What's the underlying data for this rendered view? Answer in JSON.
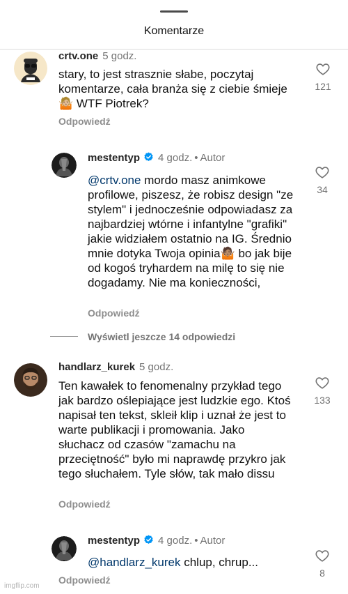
{
  "header": {
    "title": "Komentarze"
  },
  "comments": [
    {
      "username": "crtv.one",
      "time": "5 godz.",
      "text": "stary, to jest strasznie słabe, poczytaj komentarze, cała branża się z ciebie śmieje 🤷🏼 WTF Piotrek?",
      "likes": "121",
      "reply_label": "Odpowiedź"
    },
    {
      "username": "mestentyp",
      "verified": true,
      "time": "4 godz.",
      "separator": "•",
      "author_label": "Autor",
      "mention": "@crtv.one",
      "text": " mordo masz animkowe profilowe, piszesz, że robisz design \"ze stylem\" i jednocześnie odpowiadasz za najbardziej wtórne i infantylne \"grafiki\" jakie widziałem ostatnio na IG. Średnio mnie dotyka Twoja opinia🤷🏽 bo jak bije od kogoś tryhardem na milę to się nie dogadamy. Nie ma konieczności,",
      "likes": "34",
      "reply_label": "Odpowiedź"
    },
    {
      "username": "handlarz_kurek",
      "time": "5 godz.",
      "text": "Ten kawałek to fenomenalny przykład tego jak bardzo oślepiające jest ludzkie ego. Ktoś napisał ten tekst, skleił klip i uznał że jest to warte publikacji i promowania. Jako słuchacz od czasów \"zamachu na przeciętność\" było mi naprawdę przykro jak tego słuchałem. Tyle słów, tak mało dissu",
      "likes": "133",
      "reply_label": "Odpowiedź"
    },
    {
      "username": "mestentyp",
      "verified": true,
      "time": "4 godz.",
      "separator": "•",
      "author_label": "Autor",
      "mention": "@handlarz_kurek",
      "text": " chlup, chrup...",
      "likes": "8",
      "reply_label": "Odpowiedź"
    }
  ],
  "view_more_replies": "Wyświetl jeszcze 14 odpowiedzi",
  "watermark": "imgflip.com",
  "colors": {
    "verified": "#0095f6",
    "mention": "#00376b",
    "secondary_text": "#737373"
  },
  "icons": {
    "like": "heart-outline-icon",
    "verified": "verified-badge-icon"
  }
}
